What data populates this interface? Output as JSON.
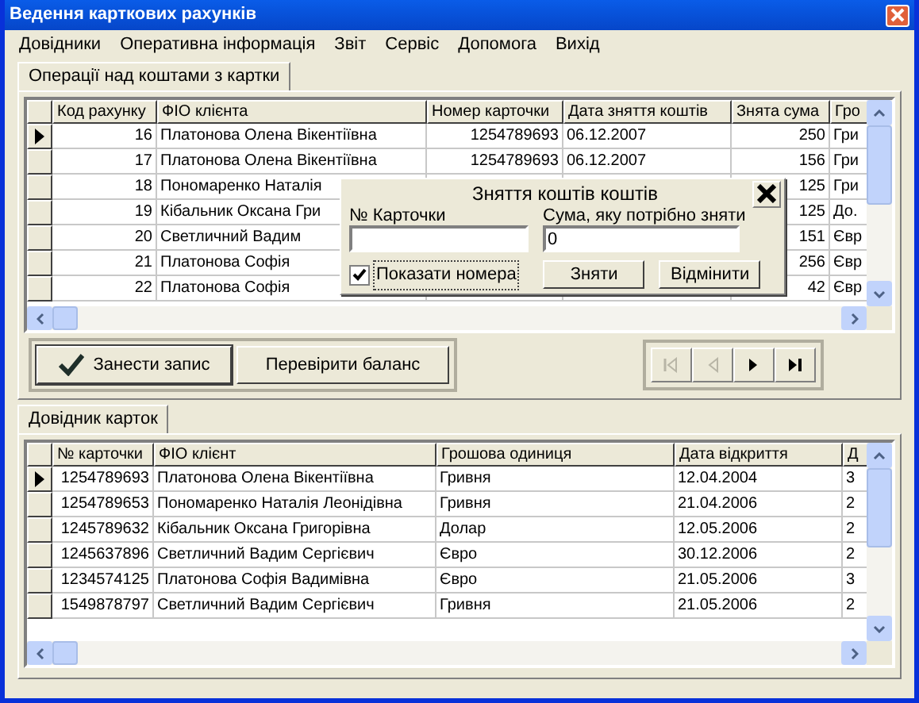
{
  "window": {
    "title": "Ведення карткових рахунків"
  },
  "menu": [
    "Довідники",
    "Оперативна інформація",
    "Звіт",
    "Сервіс",
    "Допомога",
    "Вихід"
  ],
  "operations_tab": {
    "label": "Операції над коштами з картки",
    "selected": true
  },
  "operations_grid": {
    "columns": [
      "Код рахунку",
      "ФІО клієнта",
      "Номер карточки",
      "Дата зняття коштів",
      "Знята сума",
      "Гро"
    ],
    "rows": [
      {
        "selected": true,
        "code": "16",
        "client": "Платонова Олена Вікентіївна",
        "card": "1254789693",
        "date": "06.12.2007",
        "sum": "250",
        "column_6": "Гри"
      },
      {
        "selected": false,
        "code": "17",
        "client": "Платонова Олена Вікентіївна",
        "card": "1254789693",
        "date": "06.12.2007",
        "sum": "156",
        "column_6": "Гри"
      },
      {
        "selected": false,
        "code": "18",
        "client": "Пономаренко Наталія",
        "sum": "125",
        "column_6": "Гри"
      },
      {
        "selected": false,
        "code": "19",
        "client": "Кібальник Оксана Гри",
        "sum": "125",
        "column_6": "До."
      },
      {
        "selected": false,
        "code": "20",
        "client": "Светличний Вадим",
        "sum": "151",
        "column_6": "Євр"
      },
      {
        "selected": false,
        "code": "21",
        "client": "Платонова Софія",
        "sum": "256",
        "column_6": "Євр"
      },
      {
        "selected": false,
        "code": "22",
        "client": "Платонова Софія",
        "sum": "42",
        "column_6": "Євр"
      }
    ]
  },
  "dialog": {
    "title": "Зняття коштів коштів",
    "card_label": "№ Карточки",
    "sum_label": "Сума, яку потрібно зняти",
    "sum_value": "0",
    "show_numbers": {
      "label": "Показати номера",
      "checked": true
    },
    "buttons": [
      "Зняти",
      "Відмінити"
    ]
  },
  "actions": [
    {
      "label": "Занести запис",
      "kind": "check"
    },
    {
      "label": "Перевірити баланс",
      "kind": "plain"
    }
  ],
  "navigator": [
    {
      "kind": "first",
      "disabled": true
    },
    {
      "kind": "prior",
      "disabled": true
    },
    {
      "kind": "next",
      "disabled": false
    },
    {
      "kind": "last",
      "disabled": false
    }
  ],
  "cards_tab": {
    "label": "Довідник карток",
    "selected": true
  },
  "cards_grid": {
    "columns": [
      "№ карточки",
      "ФІО клієнт",
      "Грошова одиниця",
      "Дата відкриття",
      "Д"
    ],
    "rows": [
      {
        "selected": true,
        "card": "1254789693",
        "client": "Платонова Олена Вікентіївна",
        "currency": "Гривня",
        "opened": "12.04.2004",
        "column_5": "3"
      },
      {
        "selected": false,
        "card": "1254789653",
        "client": "Пономаренко Наталія Леонідівна",
        "currency": "Гривня",
        "opened": "21.04.2006",
        "column_5": "2"
      },
      {
        "selected": false,
        "card": "1245789632",
        "client": "Кібальник Оксана Григорівна",
        "currency": "Долар",
        "opened": "12.05.2006",
        "column_5": "2"
      },
      {
        "selected": false,
        "card": "1245637896",
        "client": "Светличний Вадим Сергієвич",
        "currency": "Євро",
        "opened": "30.12.2006",
        "column_5": "2"
      },
      {
        "selected": false,
        "card": "1234574125",
        "client": "Платонова Софія Вадимівна",
        "currency": "Євро",
        "opened": "21.05.2006",
        "column_5": "3"
      },
      {
        "selected": false,
        "card": "1549878797",
        "client": "Светличний Вадим Сергієвич",
        "currency": "Гривня",
        "opened": "21.05.2006",
        "column_5": "2"
      }
    ]
  }
}
